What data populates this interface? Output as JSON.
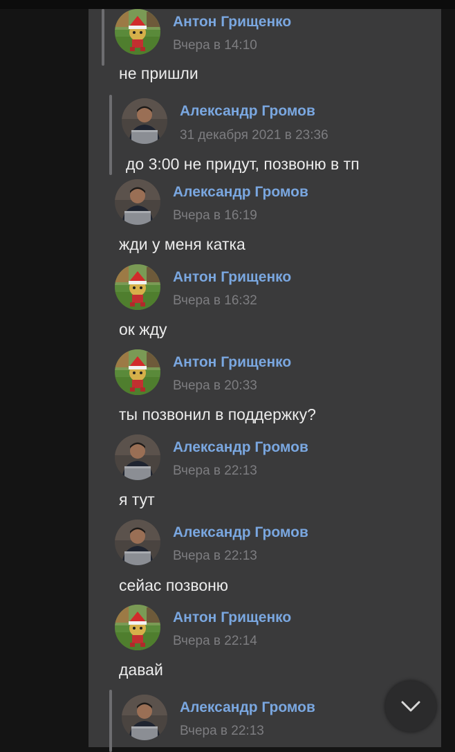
{
  "messages": [
    {
      "author": "Антон Грищенко",
      "time": "Вчера в 14:10",
      "text": "не пришли",
      "avatar": "anton"
    },
    {
      "author": "Александр Громов",
      "time": "31 декабря 2021 в 23:36",
      "text": "до 3:00 не придут, позвоню в тп",
      "avatar": "alexander",
      "quoted": true
    },
    {
      "author": "Александр Громов",
      "time": "Вчера в 16:19",
      "text": "жди у меня катка",
      "avatar": "alexander"
    },
    {
      "author": "Антон Грищенко",
      "time": "Вчера в 16:32",
      "text": "ок жду",
      "avatar": "anton"
    },
    {
      "author": "Антон Грищенко",
      "time": "Вчера в 20:33",
      "text": "ты позвонил в поддержку?",
      "avatar": "anton"
    },
    {
      "author": "Александр Громов",
      "time": "Вчера в 22:13",
      "text": "я тут",
      "avatar": "alexander"
    },
    {
      "author": "Александр Громов",
      "time": "Вчера в 22:13",
      "text": "сейас позвоню",
      "avatar": "alexander"
    },
    {
      "author": "Антон Грищенко",
      "time": "Вчера в 22:14",
      "text": "давай",
      "avatar": "anton"
    },
    {
      "author": "Александр Громов",
      "time": "Вчера в 22:13",
      "text": "",
      "avatar": "alexander",
      "quoted": true
    }
  ],
  "icons": {
    "scroll_down": "chevron-down-icon"
  },
  "colors": {
    "name": "#7aa7e0",
    "time": "#7d7d80",
    "text": "#ececec",
    "panel": "#3a3a3b"
  }
}
